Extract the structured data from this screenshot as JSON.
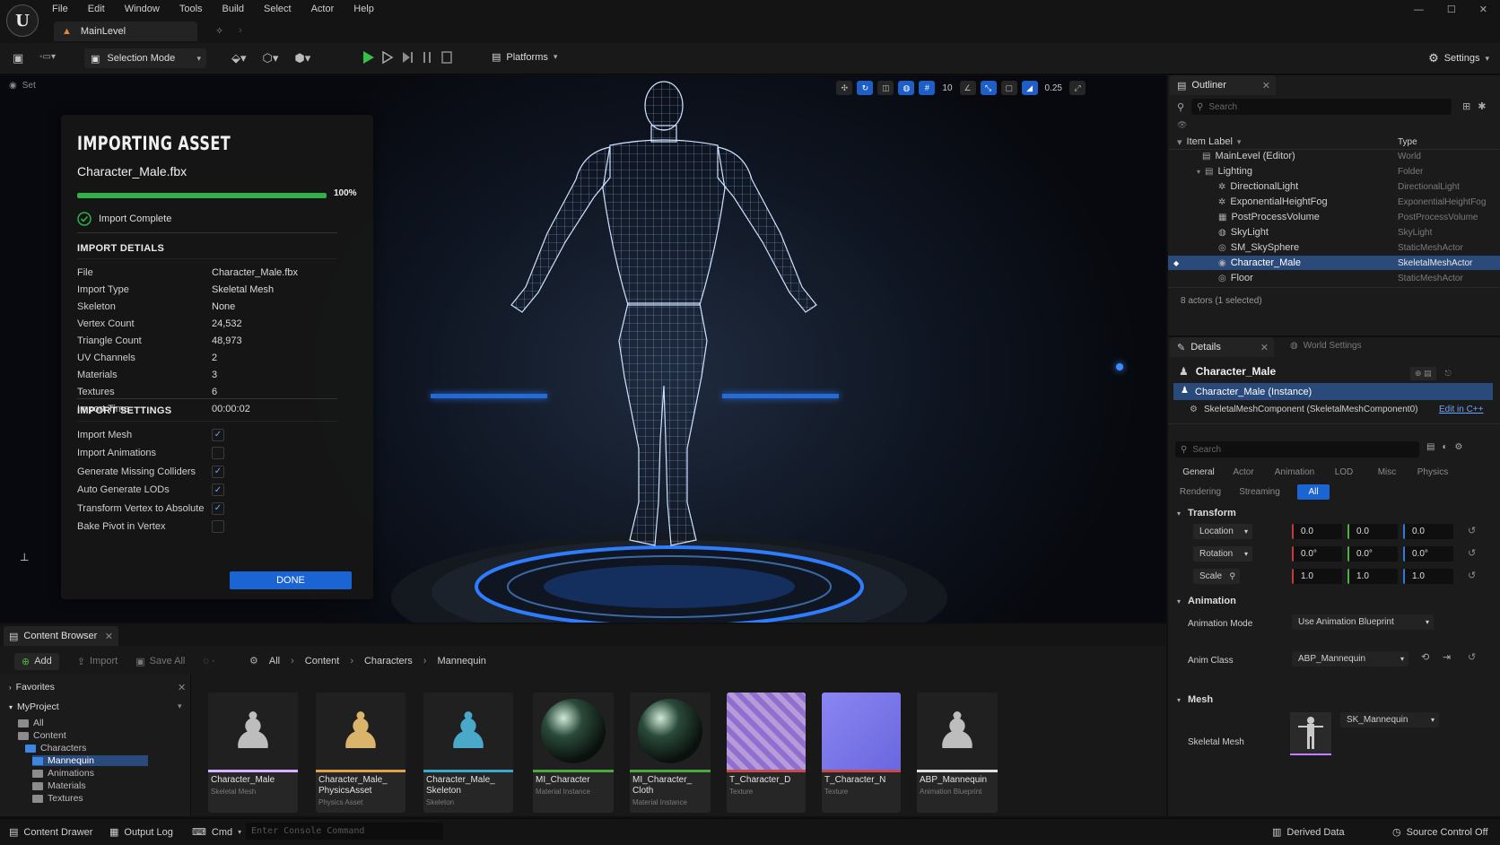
{
  "menubar": [
    "File",
    "Edit",
    "Window",
    "Tools",
    "Build",
    "Select",
    "Actor",
    "Help"
  ],
  "document_tab": "MainLevel",
  "toolbar": {
    "mode": "Selection Mode",
    "platforms": "Platforms",
    "settings": "Settings"
  },
  "viewport": {
    "top_left_label": "Set",
    "snap_value": "10",
    "camera_speed": "0.25"
  },
  "import_panel": {
    "title": "IMPORTING ASSET",
    "file": "Character_Male.fbx",
    "progress": 1.0,
    "progress_label": "100%",
    "status": "Import Complete",
    "details_title": "IMPORT DETIALS",
    "details": [
      {
        "key": "File",
        "value": "Character_Male.fbx"
      },
      {
        "key": "Import Type",
        "value": "Skeletal Mesh"
      },
      {
        "key": "Skeleton",
        "value": "None"
      },
      {
        "key": "Vertex Count",
        "value": "24,532"
      },
      {
        "key": "Triangle Count",
        "value": "48,973"
      },
      {
        "key": "UV Channels",
        "value": "2"
      },
      {
        "key": "Materials",
        "value": "3"
      },
      {
        "key": "Textures",
        "value": "6"
      },
      {
        "key": "Import Time",
        "value": "00:00:02"
      }
    ],
    "settings_title": "IMPORT SETTINGS",
    "settings": [
      {
        "key": "Import Mesh",
        "checked": true
      },
      {
        "key": "Import Animations",
        "checked": false
      },
      {
        "key": "Generate Missing Colliders",
        "checked": true
      },
      {
        "key": "Auto Generate LODs",
        "checked": true
      },
      {
        "key": "Transform Vertex to Absolute",
        "checked": true
      },
      {
        "key": "Bake Pivot in Vertex",
        "checked": false
      }
    ],
    "done_label": "DONE"
  },
  "outliner": {
    "tab_label": "Outliner",
    "search_placeholder": "Search",
    "col_label": "Item Label",
    "col_type": "Type",
    "rows": [
      {
        "name": "MainLevel (Editor)",
        "type": "World"
      },
      {
        "name": "Lighting",
        "type": "Folder"
      },
      {
        "name": "DirectionalLight",
        "type": "DirectionalLight"
      },
      {
        "name": "ExponentialHeightFog",
        "type": "ExponentialHeightFog"
      },
      {
        "name": "PostProcessVolume",
        "type": "PostProcessVolume"
      },
      {
        "name": "SkyLight",
        "type": "SkyLight"
      },
      {
        "name": "SM_SkySphere",
        "type": "StaticMeshActor"
      },
      {
        "name": "Character_Male",
        "type": "SkeletalMeshActor"
      },
      {
        "name": "Floor",
        "type": "StaticMeshActor"
      }
    ],
    "footer": "8 actors (1 selected)"
  },
  "details": {
    "tab_label": "Details",
    "world_settings_label": "World Settings",
    "actor_name": "Character_Male",
    "instance_label": "Character_Male (Instance)",
    "component_label": "SkeletalMeshComponent (SkeletalMeshComponent0)",
    "edit_link": "Edit in C++",
    "search_placeholder": "Search",
    "categories_row1": [
      "General",
      "Actor",
      "Animation",
      "LOD",
      "Misc",
      "Physics"
    ],
    "categories_row2": [
      "Rendering",
      "Streaming",
      "All"
    ],
    "transform_header": "Transform",
    "location_label": "Location",
    "rotation_label": "Rotation",
    "scale_label": "Scale",
    "location": [
      "0.0",
      "0.0",
      "0.0"
    ],
    "rotation": [
      "0.0°",
      "0.0°",
      "0.0°"
    ],
    "scale": [
      "1.0",
      "1.0",
      "1.0"
    ],
    "animation_header": "Animation",
    "anim_mode_label": "Animation Mode",
    "anim_mode_value": "Use Animation Blueprint",
    "anim_class_label": "Anim Class",
    "anim_class_value": "ABP_Mannequin",
    "mesh_header": "Mesh",
    "skeletal_mesh_label": "Skeletal Mesh",
    "skeletal_mesh_value": "SK_Mannequin"
  },
  "content_browser": {
    "tab_label": "Content Browser",
    "add_label": "Add",
    "import_label": "Import",
    "save_all_label": "Save All",
    "path": [
      "All",
      "Content",
      "Characters",
      "Mannequin"
    ],
    "favorites_label": "Favorites",
    "project_label": "MyProject",
    "tree": [
      "All",
      "Content",
      "Characters",
      "Mannequin",
      "Animations",
      "Materials",
      "Textures"
    ],
    "assets": [
      {
        "name": "Character_Male",
        "type": "Skeletal Mesh",
        "bar": "#d8b2ff"
      },
      {
        "name": "Character_Male_\nPhysicsAsset",
        "type": "Physics Asset",
        "bar": "#e0a050"
      },
      {
        "name": "Character_Male_\nSkeleton",
        "type": "Skeleton",
        "bar": "#3aa9c9"
      },
      {
        "name": "MI_Character",
        "type": "Material Instance",
        "bar": "#4caa3c"
      },
      {
        "name": "MI_Character_\nCloth",
        "type": "Material Instance",
        "bar": "#4caa3c"
      },
      {
        "name": "T_Character_D",
        "type": "Texture",
        "bar": "#c94a4a"
      },
      {
        "name": "T_Character_N",
        "type": "Texture",
        "bar": "#c94a4a"
      },
      {
        "name": "ABP_Mannequin",
        "type": "Animation Blueprint",
        "bar": "#e0e0e0"
      }
    ]
  },
  "statusbar": {
    "content_drawer": "Content Drawer",
    "output_log": "Output Log",
    "cmd": "Cmd",
    "console_placeholder": "Enter Console Command",
    "derived_data": "Derived Data",
    "source_control": "Source Control Off"
  }
}
